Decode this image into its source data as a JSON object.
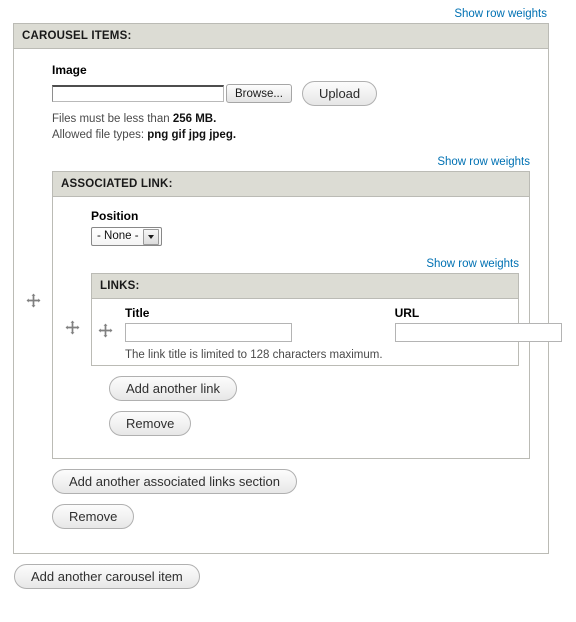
{
  "page": {
    "top_row_weights_label": "Show row weights"
  },
  "carousel": {
    "legend": "CAROUSEL ITEMS:",
    "drag_handle_icon": "move-cross-icon",
    "image": {
      "label": "Image",
      "file_value": "",
      "browse_label": "Browse...",
      "upload_label": "Upload",
      "description_line1_prefix": "Files must be less than ",
      "description_line1_bold": "256 MB.",
      "description_line2_prefix": "Allowed file types: ",
      "description_line2_bold": "png gif jpg jpeg."
    },
    "row_weights_label": "Show row weights",
    "remove_label": "Remove",
    "add_another_label": "Add another carousel item"
  },
  "associated_link": {
    "legend": "ASSOCIATED LINK:",
    "drag_handle_icon": "move-cross-icon",
    "position": {
      "label": "Position",
      "selected": "- None -",
      "options": [
        "- None -"
      ]
    },
    "row_weights_label": "Show row weights",
    "add_another_label": "Add another associated links section",
    "remove_label": "Remove"
  },
  "links": {
    "legend": "LINKS:",
    "drag_handle_icon": "move-cross-icon",
    "columns": {
      "drag": "",
      "title": "Title",
      "url": "URL"
    },
    "rows": [
      {
        "title_value": "",
        "url_value": "",
        "description": "The link title is limited to 128 characters maximum."
      }
    ],
    "add_another_label": "Add another link",
    "remove_label": "Remove"
  },
  "colors": {
    "link": "#0071b3",
    "legend_bg": "#dcdcd4",
    "border": "#bbbbb5",
    "drag_icon": "#808080"
  }
}
